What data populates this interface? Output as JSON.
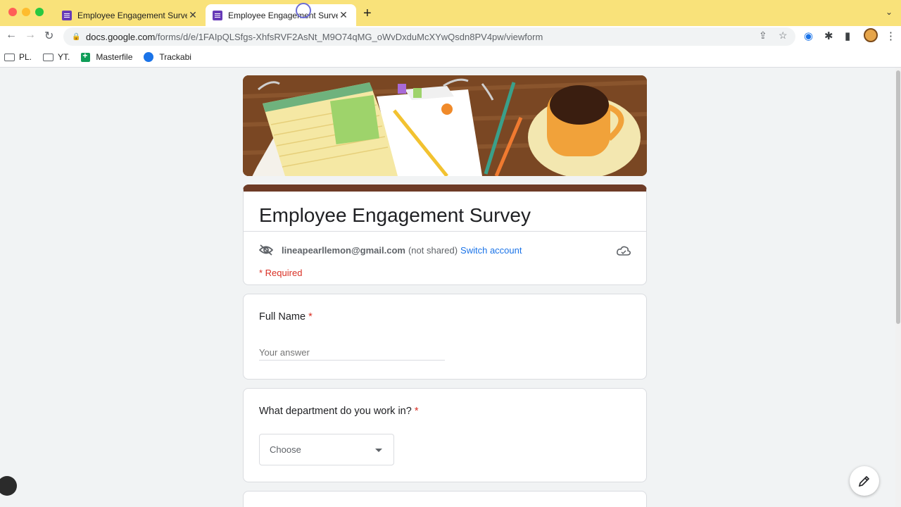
{
  "browser": {
    "tabs": [
      {
        "title": "Employee Engagement Survey",
        "active": false
      },
      {
        "title": "Employee Engagement Survey",
        "active": true
      }
    ],
    "new_tab_icon": "plus-icon",
    "url_host": "docs.google.com",
    "url_path": "/forms/d/e/1FAIpQLSfgs-XhfsRVF2AsNt_M9O74qMG_oWvDxduMcXYwQsdn8PV4pw/viewform",
    "bookmarks": [
      {
        "label": "PL.",
        "icon": "folder-icon"
      },
      {
        "label": "YT.",
        "icon": "folder-icon"
      },
      {
        "label": "Masterfile",
        "icon": "sheets-icon"
      },
      {
        "label": "Trackabi",
        "icon": "trackabi-icon"
      }
    ]
  },
  "form": {
    "title": "Employee Engagement Survey",
    "account_email": "lineapearllemon@gmail.com",
    "not_shared": "(not shared)",
    "switch_account": "Switch account",
    "required_note": "* Required",
    "accent_color": "#6d3b26",
    "questions": [
      {
        "label": "Full Name",
        "required_mark": "*",
        "placeholder": "Your answer",
        "type": "text"
      },
      {
        "label": "What department do you work in?",
        "required_mark": "*",
        "selected": "Choose",
        "type": "dropdown"
      }
    ]
  }
}
